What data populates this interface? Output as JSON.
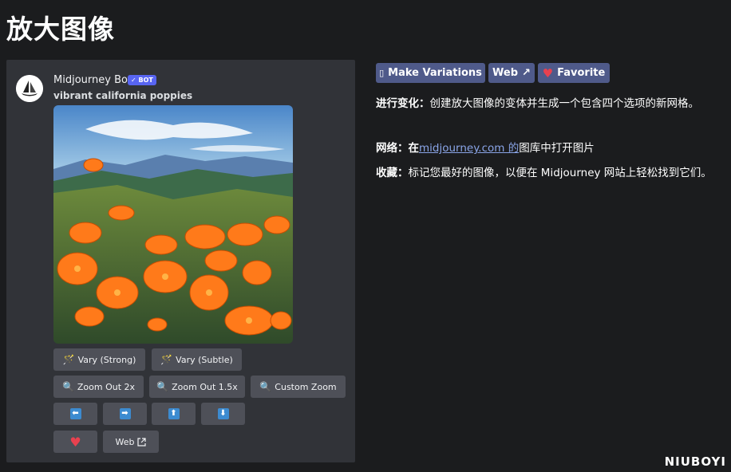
{
  "page": {
    "title": "放大图像"
  },
  "message": {
    "username": "Midjourney Bot",
    "badge": "✓ BOT",
    "prompt": "vibrant california poppies",
    "image_alt": "vibrant california poppies artwork"
  },
  "buttons": {
    "vary_strong": "Vary (Strong)",
    "vary_subtle": "Vary (Subtle)",
    "zoom_out_2x": "Zoom Out 2x",
    "zoom_out_15x": "Zoom Out 1.5x",
    "custom_zoom": "Custom Zoom",
    "pan_left": "⬅",
    "pan_right": "➡",
    "pan_up": "⬆",
    "pan_down": "⬇",
    "favorite_heart": "♥",
    "web": "Web"
  },
  "legacy_buttons": {
    "make_variations": "Make Variations",
    "web": "Web",
    "favorite": "Favorite"
  },
  "descriptions": {
    "variations_label": "进行变化：",
    "variations_text": "创建放大图像的变体并生成一个包含四个选项的新网格。",
    "web_label": "网络：",
    "web_prefix": "在",
    "web_link": "midjourney.com 的",
    "web_text": "图库中打开图片",
    "favorite_label": "收藏：",
    "favorite_text": "标记您最好的图像，以便在 Midjourney 网站上轻松找到它们。"
  },
  "watermark": "NIUBOYI",
  "colors": {
    "background": "#1b1c1e",
    "panel": "#313338",
    "button": "#4e5058",
    "legacy_button": "#4f5a8a",
    "link": "#8aa5e8",
    "heart": "#e8414f"
  }
}
